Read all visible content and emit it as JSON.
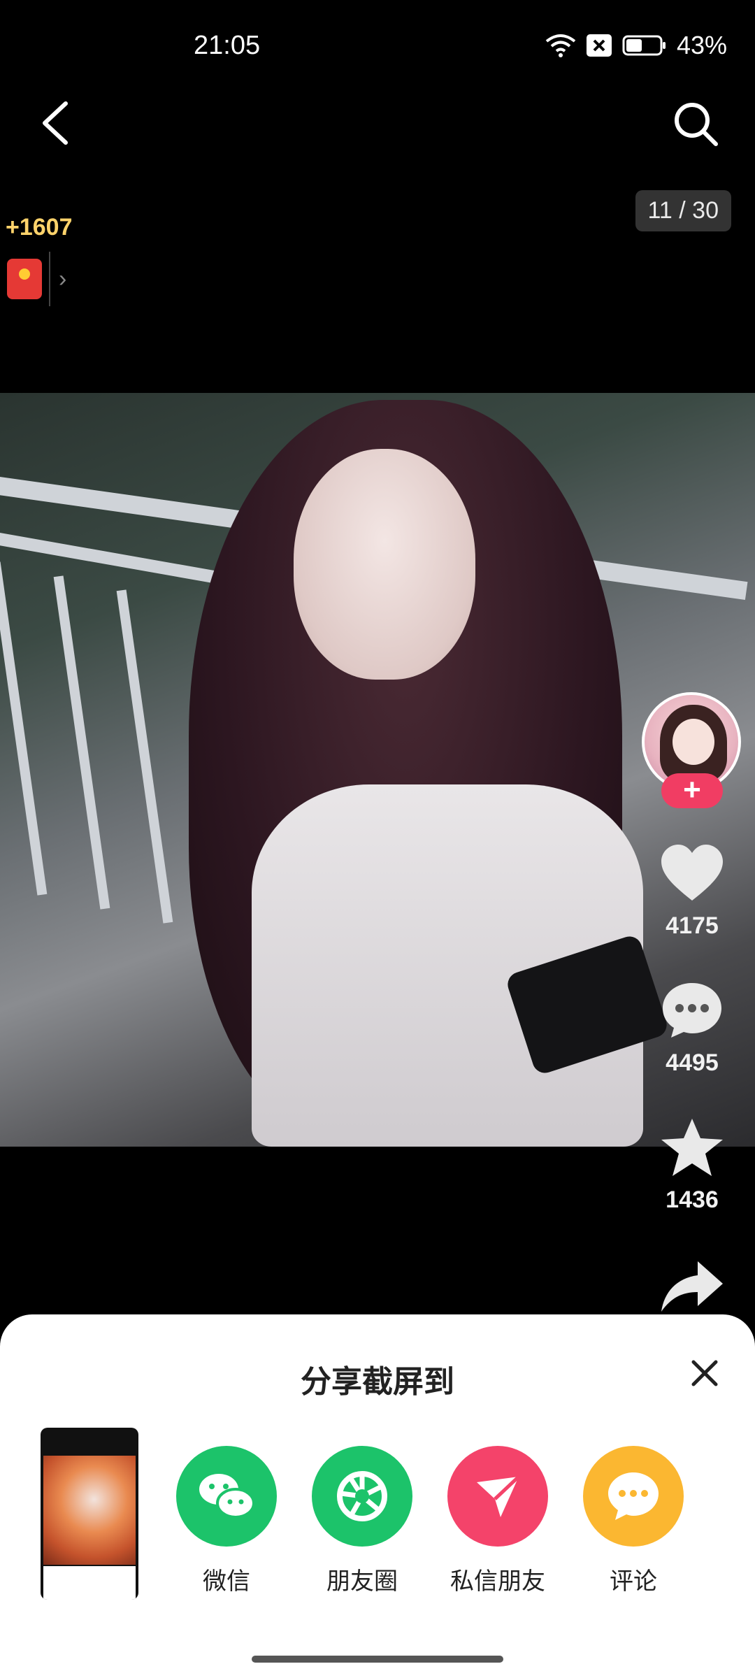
{
  "status_bar": {
    "time": "21:05",
    "battery": "43%"
  },
  "viewer": {
    "counter": "11 / 30",
    "reward": "+1607"
  },
  "actions": {
    "likes": "4175",
    "comments": "4495",
    "favorites": "1436"
  },
  "share_sheet": {
    "title": "分享截屏到",
    "targets": [
      {
        "label": "微信",
        "icon": "wechat-icon",
        "color": "#1cc36a"
      },
      {
        "label": "朋友圈",
        "icon": "moments-icon",
        "color": "#1cc36a"
      },
      {
        "label": "私信朋友",
        "icon": "send-icon",
        "color": "#f4436a"
      },
      {
        "label": "评论",
        "icon": "comment-icon",
        "color": "#fbb731"
      }
    ]
  }
}
